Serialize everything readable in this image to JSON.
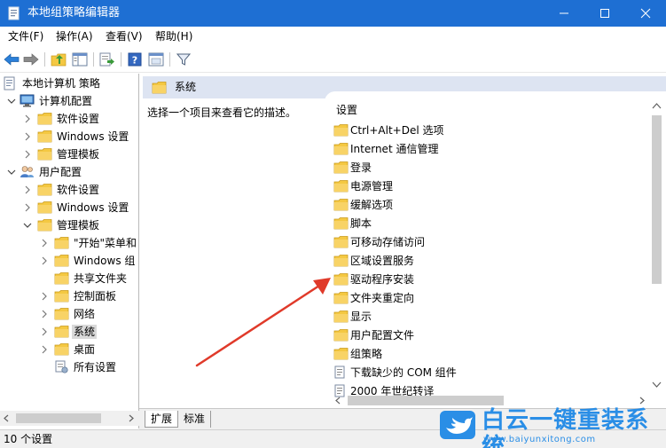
{
  "window": {
    "title": "本地组策略编辑器"
  },
  "menubar": {
    "items": [
      "文件(F)",
      "操作(A)",
      "查看(V)",
      "帮助(H)"
    ]
  },
  "toolbar": {
    "icons": [
      "back-icon",
      "forward-icon",
      "up-folder-icon",
      "show-hide-tree-icon",
      "export-list-icon",
      "help-icon",
      "properties-icon",
      "filter-icon"
    ]
  },
  "tree": {
    "items": [
      {
        "label": "本地计算机 策略",
        "icon": "policy-doc-icon"
      },
      {
        "label": "计算机配置",
        "icon": "computer-icon"
      },
      {
        "label": "软件设置",
        "icon": "folder-icon"
      },
      {
        "label": "Windows 设置",
        "icon": "folder-icon"
      },
      {
        "label": "管理模板",
        "icon": "folder-icon"
      },
      {
        "label": "用户配置",
        "icon": "users-icon"
      },
      {
        "label": "软件设置",
        "icon": "folder-icon"
      },
      {
        "label": "Windows 设置",
        "icon": "folder-icon"
      },
      {
        "label": "管理模板",
        "icon": "folder-icon"
      },
      {
        "label": "\"开始\"菜单和",
        "icon": "folder-icon"
      },
      {
        "label": "Windows 组",
        "icon": "folder-icon"
      },
      {
        "label": "共享文件夹",
        "icon": "folder-icon"
      },
      {
        "label": "控制面板",
        "icon": "folder-icon"
      },
      {
        "label": "网络",
        "icon": "folder-icon"
      },
      {
        "label": "系统",
        "icon": "folder-icon"
      },
      {
        "label": "桌面",
        "icon": "folder-icon"
      },
      {
        "label": "所有设置",
        "icon": "all-settings-icon"
      }
    ]
  },
  "content": {
    "header_title": "系统",
    "description": "选择一个项目来查看它的描述。",
    "column_header": "设置",
    "items": [
      {
        "label": "Ctrl+Alt+Del 选项",
        "icon": "folder-icon"
      },
      {
        "label": "Internet 通信管理",
        "icon": "folder-icon"
      },
      {
        "label": "登录",
        "icon": "folder-icon"
      },
      {
        "label": "电源管理",
        "icon": "folder-icon"
      },
      {
        "label": "缓解选项",
        "icon": "folder-icon"
      },
      {
        "label": "脚本",
        "icon": "folder-icon"
      },
      {
        "label": "可移动存储访问",
        "icon": "folder-icon"
      },
      {
        "label": "区域设置服务",
        "icon": "folder-icon"
      },
      {
        "label": "驱动程序安装",
        "icon": "folder-icon"
      },
      {
        "label": "文件夹重定向",
        "icon": "folder-icon"
      },
      {
        "label": "显示",
        "icon": "folder-icon"
      },
      {
        "label": "用户配置文件",
        "icon": "folder-icon"
      },
      {
        "label": "组策略",
        "icon": "folder-icon"
      },
      {
        "label": "下载缺少的 COM 组件",
        "icon": "setting-doc-icon"
      },
      {
        "label": "2000 年世纪转译",
        "icon": "setting-doc-icon"
      }
    ]
  },
  "tabs": [
    "扩展",
    "标准"
  ],
  "statusbar": {
    "text": "10 个设置"
  },
  "watermark": {
    "brand": "白云一键重装系统",
    "url": "www.baiyunxitong.com"
  },
  "colors": {
    "titlebar": "#1e6fd3",
    "folder": "#f4c842",
    "header_band": "#dde4f2",
    "arrow": "#e03a2a",
    "watermark": "#2a8ee6"
  }
}
